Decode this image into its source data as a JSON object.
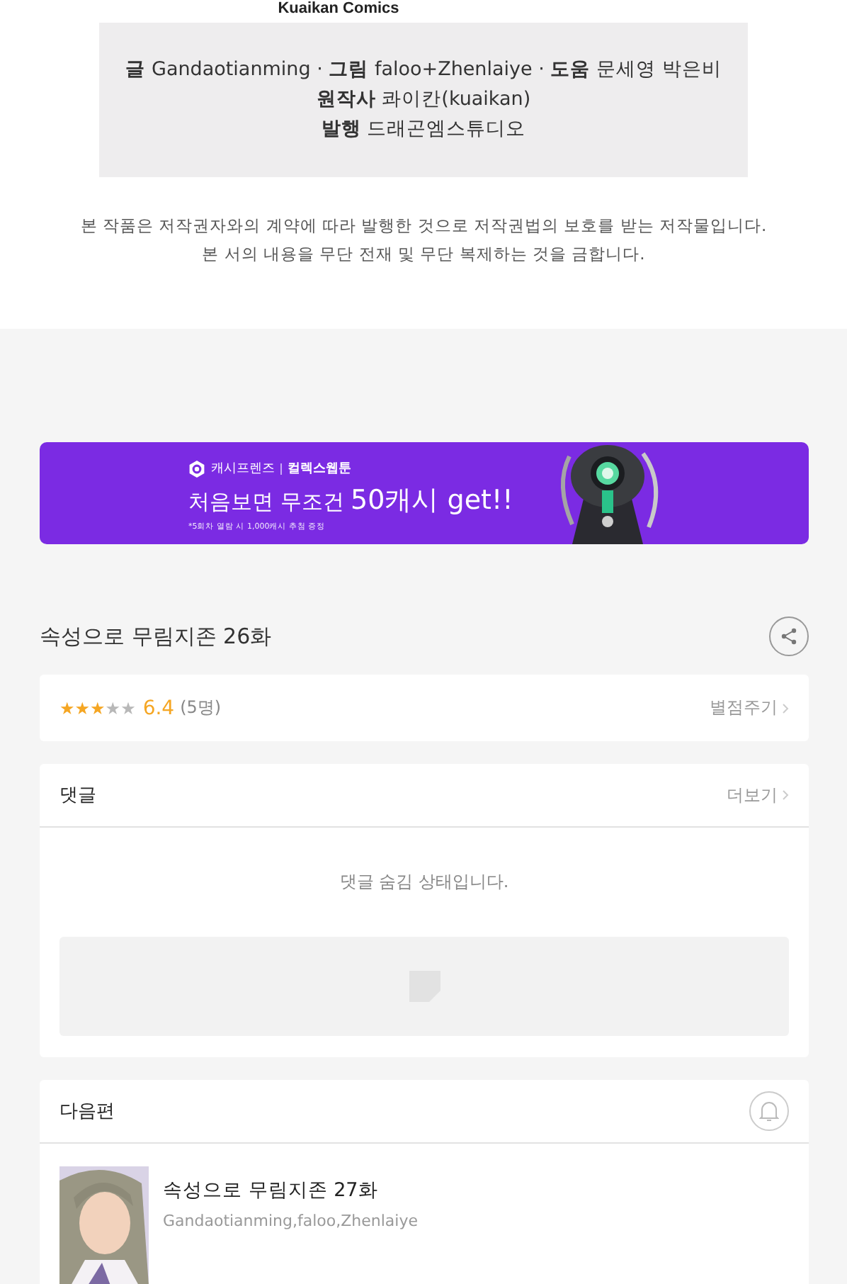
{
  "publisher_logo": "Kuaikan Comics",
  "credits": [
    "**글** Gandaotianming · **그림** faloo+Zhenlaiye · **도움** 문세영 박은비",
    "**원작사** 콰이칸(kuaikan)",
    "**발행** 드래곤엠스튜디오"
  ],
  "copyright": [
    "본 작품은 저작권자와의 계약에 따라 발행한 것으로 저작권법의 보호를 받는 저작물입니다.",
    "본 서의 내용을 무단 전재 및 무단 복제하는 것을 금합니다."
  ],
  "banner": {
    "brand": "캐시프렌즈",
    "partner": "컬렉스웹툰",
    "headline": "처음보면 무조건",
    "highlight": "50캐시 get!!",
    "fine_print": "*5회차 열람 시 1,000캐시 추첨 증정"
  },
  "episode_title": "속성으로 무림지존 26화",
  "rating": {
    "stars": 3,
    "score": "6.4",
    "count": "(5명)",
    "action": "별점주기"
  },
  "comments": {
    "title": "댓글",
    "more": "더보기",
    "notice": "댓글 숨김 상태입니다."
  },
  "next": {
    "title": "다음편",
    "episode": {
      "title": "속성으로 무림지존 27화",
      "authors": "Gandaotianming,faloo,Zhenlaiye"
    }
  }
}
